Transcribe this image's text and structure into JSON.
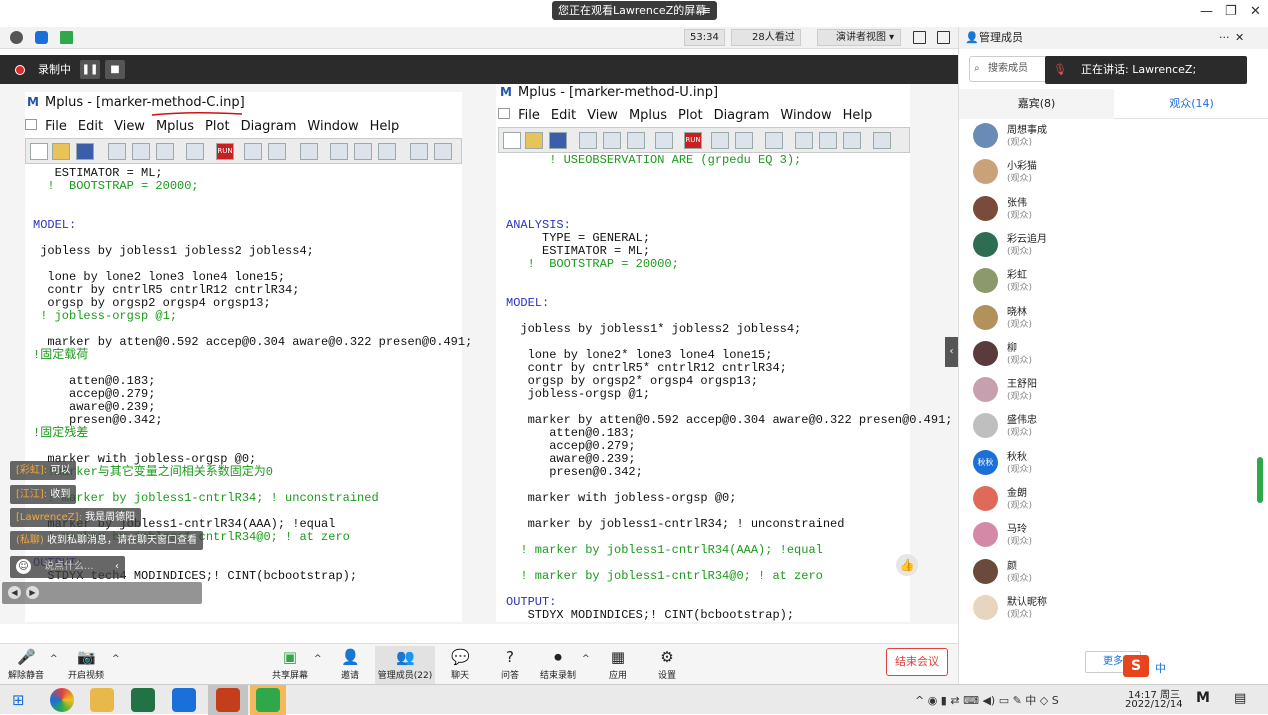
{
  "topbar": {
    "share_notice": "您正在观看LawrenceZ的屏幕",
    "menu_icon": "≡",
    "minimize": "—",
    "restore": "❐",
    "close": "✕"
  },
  "meetbar": {
    "timer": "53:34",
    "attended": "28人看过",
    "view_mode": "演讲者视图"
  },
  "recording": {
    "label": "录制中"
  },
  "left_window": {
    "title": "Mplus - [marker-method-C.inp]",
    "menus": [
      "File",
      "Edit",
      "View",
      "Mplus",
      "Plot",
      "Diagram",
      "Window",
      "Help"
    ],
    "lines": [
      {
        "t": "   ESTIMATOR = ML;",
        "c": ""
      },
      {
        "t": "  !  BOOTSTRAP = 20000;",
        "c": "g"
      },
      {
        "t": "",
        "c": ""
      },
      {
        "t": "",
        "c": ""
      },
      {
        "t": "MODEL:",
        "c": "b"
      },
      {
        "t": "",
        "c": ""
      },
      {
        "t": " jobless by jobless1 jobless2 jobless4;",
        "c": ""
      },
      {
        "t": "",
        "c": ""
      },
      {
        "t": "  lone by lone2 lone3 lone4 lone15;",
        "c": ""
      },
      {
        "t": "  contr by cntrlR5 cntrlR12 cntrlR34;",
        "c": ""
      },
      {
        "t": "  orgsp by orgsp2 orgsp4 orgsp13;",
        "c": ""
      },
      {
        "t": " ! jobless-orgsp @1;",
        "c": "g"
      },
      {
        "t": "",
        "c": ""
      },
      {
        "t": "  marker by atten@0.592 accep@0.304 aware@0.322 presen@0.491;",
        "c": ""
      },
      {
        "t": "!固定载荷",
        "c": "g"
      },
      {
        "t": "",
        "c": ""
      },
      {
        "t": "     atten@0.183;",
        "c": ""
      },
      {
        "t": "     accep@0.279;",
        "c": ""
      },
      {
        "t": "     aware@0.239;",
        "c": ""
      },
      {
        "t": "     presen@0.342;",
        "c": ""
      },
      {
        "t": "!固定残差",
        "c": "g"
      },
      {
        "t": "",
        "c": ""
      },
      {
        "t": "  marker with jobless-orgsp @0;",
        "c": ""
      },
      {
        "t": "  !marker与其它变量之间相关系数固定为0",
        "c": "g"
      },
      {
        "t": "",
        "c": ""
      },
      {
        "t": "  ! marker by jobless1-cntrlR34; ! unconstrained",
        "c": "g"
      },
      {
        "t": "",
        "c": ""
      },
      {
        "t": "  marker by jobless1-cntrlR34(AAA); !equal",
        "c": ""
      },
      {
        "t": "  ! marker by jobless1-cntrlR34@0; ! at zero",
        "c": "g"
      },
      {
        "t": "",
        "c": ""
      },
      {
        "t": "OUTPUT:",
        "c": "b"
      },
      {
        "t": "  STDYX tech4 MODINDICES;! CINT(bcbootstrap);",
        "c": ""
      }
    ]
  },
  "right_window": {
    "title": "Mplus - [marker-method-U.inp]",
    "menus": [
      "File",
      "Edit",
      "View",
      "Mplus",
      "Plot",
      "Diagram",
      "Window",
      "Help"
    ],
    "lines": [
      {
        "t": "      ! USEOBSERVATION ARE (grpedu EQ 3);",
        "c": "g"
      },
      {
        "t": "",
        "c": ""
      },
      {
        "t": "",
        "c": ""
      },
      {
        "t": "",
        "c": ""
      },
      {
        "t": "",
        "c": ""
      },
      {
        "t": "ANALYSIS:",
        "c": "b"
      },
      {
        "t": "     TYPE = GENERAL;",
        "c": ""
      },
      {
        "t": "     ESTIMATOR = ML;",
        "c": ""
      },
      {
        "t": "   !  BOOTSTRAP = 20000;",
        "c": "g"
      },
      {
        "t": "",
        "c": ""
      },
      {
        "t": "",
        "c": ""
      },
      {
        "t": "MODEL:",
        "c": "b"
      },
      {
        "t": "",
        "c": ""
      },
      {
        "t": "  jobless by jobless1* jobless2 jobless4;",
        "c": ""
      },
      {
        "t": "",
        "c": ""
      },
      {
        "t": "   lone by lone2* lone3 lone4 lone15;",
        "c": ""
      },
      {
        "t": "   contr by cntrlR5* cntrlR12 cntrlR34;",
        "c": ""
      },
      {
        "t": "   orgsp by orgsp2* orgsp4 orgsp13;",
        "c": ""
      },
      {
        "t": "   jobless-orgsp @1;",
        "c": ""
      },
      {
        "t": "",
        "c": ""
      },
      {
        "t": "   marker by atten@0.592 accep@0.304 aware@0.322 presen@0.491;",
        "c": ""
      },
      {
        "t": "      atten@0.183;",
        "c": ""
      },
      {
        "t": "      accep@0.279;",
        "c": ""
      },
      {
        "t": "      aware@0.239;",
        "c": ""
      },
      {
        "t": "      presen@0.342;",
        "c": ""
      },
      {
        "t": "",
        "c": ""
      },
      {
        "t": "   marker with jobless-orgsp @0;",
        "c": ""
      },
      {
        "t": "",
        "c": ""
      },
      {
        "t": "   marker by jobless1-cntrlR34; ! unconstrained",
        "c": ""
      },
      {
        "t": "",
        "c": ""
      },
      {
        "t": "  ! marker by jobless1-cntrlR34(AAA); !equal",
        "c": "g"
      },
      {
        "t": "",
        "c": ""
      },
      {
        "t": "  ! marker by jobless1-cntrlR34@0; ! at zero",
        "c": "g"
      },
      {
        "t": "",
        "c": ""
      },
      {
        "t": "OUTPUT:",
        "c": "b"
      },
      {
        "t": "   STDYX MODINDICES;! CINT(bcbootstrap);",
        "c": ""
      }
    ]
  },
  "chat": {
    "messages": [
      {
        "name": "[彩虹]:",
        "text": "可以"
      },
      {
        "name": "[江江]:",
        "text": "收到"
      },
      {
        "name": "[LawrenceZ]:",
        "text": "我是周德阳"
      },
      {
        "name": "(私聊)",
        "text": "收到私聊消息，请在聊天窗口查看"
      }
    ],
    "input_placeholder": "说点什么..."
  },
  "right_panel": {
    "title": "管理成员",
    "search_placeholder": "搜索成员",
    "speaking": "正在讲话: LawrenceZ;",
    "tab_guests": "嘉宾(8)",
    "tab_audience": "观众(14)",
    "members": [
      {
        "name": "周想事成",
        "role": "(观众)",
        "color": "#6a8bb5"
      },
      {
        "name": "小彩猫",
        "role": "(观众)",
        "color": "#c9a27a"
      },
      {
        "name": "张伟",
        "role": "(观众)",
        "color": "#7a4b3a"
      },
      {
        "name": "彩云追月",
        "role": "(观众)",
        "color": "#2c6e4f"
      },
      {
        "name": "彩虹",
        "role": "(观众)",
        "color": "#8a9a6a"
      },
      {
        "name": "晓林",
        "role": "(观众)",
        "color": "#b0925a"
      },
      {
        "name": "柳",
        "role": "(观众)",
        "color": "#5a3a3a"
      },
      {
        "name": "王舒阳",
        "role": "(观众)",
        "color": "#c7a0b0"
      },
      {
        "name": "盛伟忠",
        "role": "(观众)",
        "color": "#bfbfbf"
      },
      {
        "name": "秋秋",
        "role": "(观众)",
        "color": "#1a6fd8",
        "initial": "秋秋"
      },
      {
        "name": "金朗",
        "role": "(观众)",
        "color": "#e06a5a"
      },
      {
        "name": "马玲",
        "role": "(观众)",
        "color": "#d48aa6"
      },
      {
        "name": "颜",
        "role": "(观众)",
        "color": "#6a4a3a"
      },
      {
        "name": "默认昵称",
        "role": "(观众)",
        "color": "#e8d5c0"
      }
    ],
    "more": "更多"
  },
  "bottombar": {
    "buttons": [
      "解除静音",
      "开启视频",
      "共享屏幕",
      "邀请",
      "管理成员(22)",
      "聊天",
      "问答",
      "结束录制",
      "应用",
      "设置"
    ],
    "end_meeting": "结束会议"
  },
  "taskbar": {
    "time": "14:17 周三",
    "date": "2022/12/14",
    "ime": "中"
  }
}
